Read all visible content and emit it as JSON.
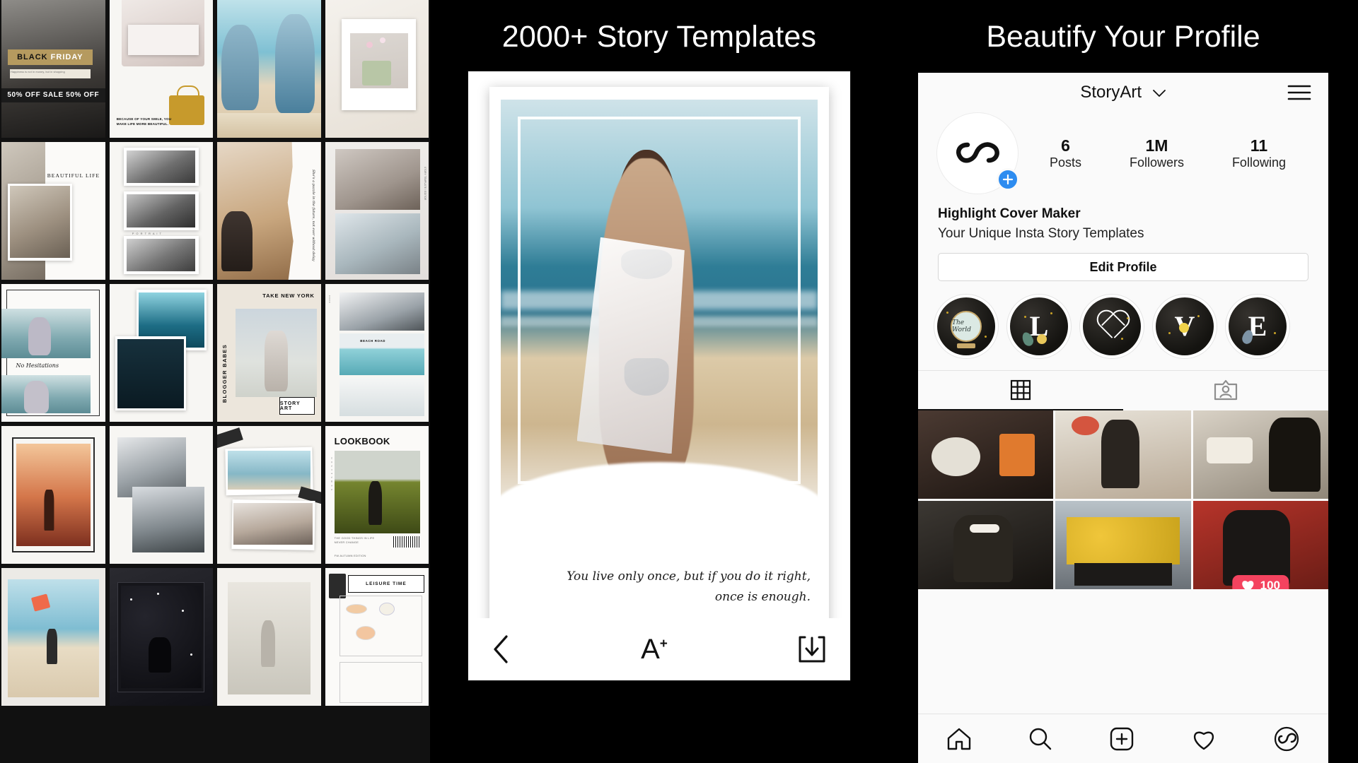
{
  "panels": {
    "templates": {
      "tiles": [
        {
          "id": "black-friday",
          "label": "BLACK",
          "label2": "FRIDAY",
          "strip": "50% OFF SALE 50% OFF",
          "sub": "Happiness is not in money, but in shopping"
        },
        {
          "id": "smile-bag",
          "caption": "BECAUSE OF YOUR SMILE, YOU MAKE LIFE MORE BEAUTIFUL."
        },
        {
          "id": "beach-friends",
          "caption": ""
        },
        {
          "id": "flower-vase",
          "caption": ""
        },
        {
          "id": "beautiful-life",
          "label": "BEAUTIFUL LIFE"
        },
        {
          "id": "bw-triptych",
          "caption": "P O R T R A I T"
        },
        {
          "id": "torn-city",
          "script": "She's a puzzle in the future, not ever without delay"
        },
        {
          "id": "veil-duo",
          "caption": ""
        },
        {
          "id": "no-hesitations",
          "script": "No Hesitations"
        },
        {
          "id": "underwater",
          "caption": ""
        },
        {
          "id": "take-new-york",
          "label": "TAKE NEW YORK",
          "vertical": "BLOGGER BABES",
          "tag": "STORY ART"
        },
        {
          "id": "beach-road",
          "label": "BEACH ROAD"
        },
        {
          "id": "sunset-door",
          "caption": ""
        },
        {
          "id": "stairs-mono",
          "caption": ""
        },
        {
          "id": "polaroid-tape",
          "caption": ""
        },
        {
          "id": "lookbook",
          "label": "LOOKBOOK",
          "caption": "THE GOOD THINGS IN LIFE NEVER CHANGE",
          "footer": "FW AUTUMN EDITION"
        },
        {
          "id": "kite-beach",
          "caption": ""
        },
        {
          "id": "night-stars",
          "caption": ""
        },
        {
          "id": "field-jump",
          "caption": ""
        },
        {
          "id": "leisure-time",
          "label": "LEISURE TIME"
        }
      ]
    },
    "editor": {
      "title": "2000+ Story Templates",
      "quote_line1": "You live only once, but if you do it right,",
      "quote_line2": "once is enough.",
      "toolbar": {
        "back": "back-chevron",
        "text": "A",
        "text_sup": "+",
        "download": "download"
      }
    },
    "profile": {
      "title": "Beautify Your Profile",
      "header": {
        "username": "StoryArt",
        "chevron": "⌄",
        "menu_icon": "hamburger-menu"
      },
      "avatar": {
        "icon": "storyart-logo",
        "add_badge": "+"
      },
      "stats": [
        {
          "value": "6",
          "label": "Posts"
        },
        {
          "value": "1M",
          "label": "Followers"
        },
        {
          "value": "11",
          "label": "Following"
        }
      ],
      "bio": {
        "name": "Highlight Cover Maker",
        "description": "Your Unique Insta Story Templates"
      },
      "edit_profile_label": "Edit Profile",
      "highlights": [
        {
          "id": "globe",
          "glyph": "",
          "caption": "The World"
        },
        {
          "id": "letter-l",
          "glyph": "L",
          "caption": ""
        },
        {
          "id": "heart",
          "glyph": "",
          "caption": ""
        },
        {
          "id": "letter-v",
          "glyph": "V",
          "caption": ""
        },
        {
          "id": "letter-e",
          "glyph": "E",
          "caption": ""
        }
      ],
      "tabs": [
        {
          "id": "grid",
          "icon": "grid-icon",
          "active": true
        },
        {
          "id": "tagged",
          "icon": "tagged-icon",
          "active": false
        }
      ],
      "likes_badge": {
        "icon": "heart-filled",
        "count": "100"
      },
      "nav": [
        {
          "id": "home",
          "icon": "home-icon"
        },
        {
          "id": "search",
          "icon": "search-icon"
        },
        {
          "id": "add",
          "icon": "plus-square-icon"
        },
        {
          "id": "activity",
          "icon": "heart-icon"
        },
        {
          "id": "profile",
          "icon": "storyart-avatar-icon"
        }
      ]
    }
  },
  "colors": {
    "background": "#000000",
    "panel": "#fafafa",
    "accent_blue": "#2d8cf0",
    "badge_red": "#f4435f",
    "text": "#111111"
  }
}
